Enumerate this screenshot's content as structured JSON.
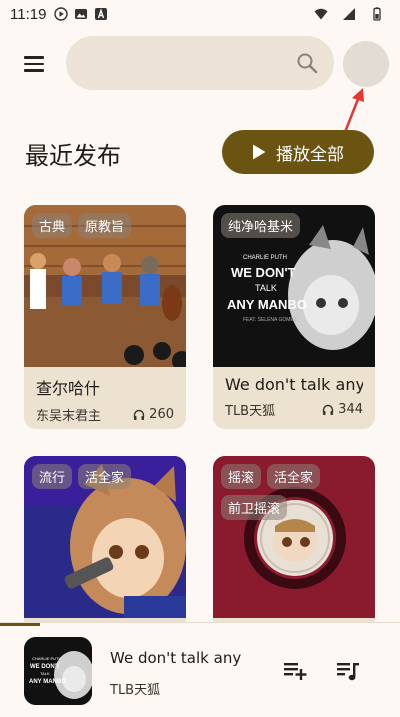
{
  "status_bar": {
    "time": "11:19",
    "icons": [
      "play-circle-icon",
      "image-icon",
      "a-letter-icon",
      "wifi-icon",
      "signal-icon",
      "battery-icon"
    ]
  },
  "top_bar": {
    "menu_icon": "hamburger-menu-icon",
    "search": {
      "placeholder": "",
      "value": "",
      "icon": "search-icon"
    },
    "avatar_icon": "avatar"
  },
  "section": {
    "title": "最近发布",
    "play_all_label": "播放全部",
    "play_icon": "play-icon"
  },
  "cards": [
    {
      "tags": [
        "古典",
        "原教旨"
      ],
      "title": "查尔哈什",
      "artist": "东吴末君主",
      "plays": "260",
      "cover_desc": "string quartet anime illustration"
    },
    {
      "tags": [
        "纯净哈基米"
      ],
      "title": "We don't talk any",
      "artist": "TLB天狐",
      "plays": "344",
      "cover_lines": [
        "CHARLIE PUTH",
        "WE DON'T",
        "TALK",
        "ANY MANBO",
        "FEAT. SELENA GOMEZ"
      ]
    },
    {
      "tags": [
        "流行",
        "活全家"
      ],
      "title": "",
      "artist": "",
      "plays": ""
    },
    {
      "tags": [
        "摇滚",
        "活全家",
        "前卫摇滚"
      ],
      "title": "",
      "artist": "",
      "plays": ""
    }
  ],
  "player": {
    "title": "We don't talk any",
    "artist": "TLB天狐",
    "progress": 0.1,
    "cover_lines": [
      "CHARLIE PUTH",
      "WE DON'T",
      "TALK",
      "ANY MANBO"
    ],
    "queue_add_icon": "playlist-add-icon",
    "playlist_icon": "queue-music-icon"
  },
  "colors": {
    "accent": "#6b5312",
    "background": "#fdf8f3",
    "card": "#ede1cf",
    "search": "#ece3d6"
  }
}
